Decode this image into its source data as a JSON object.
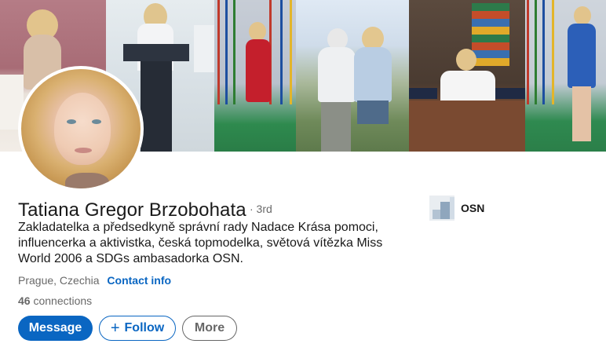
{
  "profile": {
    "name": "Tatiana Gregor Brzobohata",
    "degree": "· 3rd",
    "headline": "Zakladatelka a předsedkyně správní rady Nadace Krása pomoci, influencerka a aktivistka, česká topmodelka, světová vítězka Miss World 2006 a SDGs ambasadorka OSN.",
    "location": "Prague, Czechia",
    "contact_info_label": "Contact info",
    "connections_count": "46",
    "connections_label": "connections"
  },
  "actions": {
    "message_label": "Message",
    "follow_label": "Follow",
    "more_label": "More"
  },
  "experience_highlight": {
    "org_name": "OSN"
  },
  "icons": {
    "follow": "plus-icon",
    "org": "organization-logo-icon"
  },
  "colors": {
    "primary": "#0a66c2",
    "text_secondary": "#666666"
  }
}
